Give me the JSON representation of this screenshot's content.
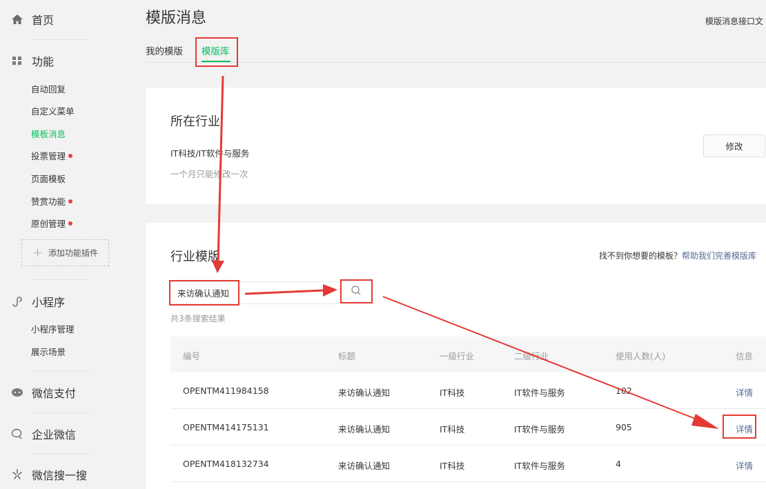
{
  "sidebar": {
    "home": "首页",
    "function": "功能",
    "function_items": [
      {
        "label": "自动回复",
        "dot": false,
        "active": false
      },
      {
        "label": "自定义菜单",
        "dot": false,
        "active": false
      },
      {
        "label": "模板消息",
        "dot": false,
        "active": true
      },
      {
        "label": "投票管理",
        "dot": true,
        "active": false
      },
      {
        "label": "页面模板",
        "dot": false,
        "active": false
      },
      {
        "label": "赞赏功能",
        "dot": true,
        "active": false
      },
      {
        "label": "原创管理",
        "dot": true,
        "active": false
      }
    ],
    "add_plugin": "添加功能插件",
    "miniprogram": "小程序",
    "miniprogram_items": [
      "小程序管理",
      "展示场景"
    ],
    "wechat_pay": "微信支付",
    "work_wechat": "企业微信",
    "wechat_search": "微信搜一搜"
  },
  "header": {
    "title": "模版消息",
    "top_link": "模版消息接口文"
  },
  "tabs": [
    "我的模版",
    "模版库"
  ],
  "industry": {
    "title": "所在行业",
    "value": "IT科技/IT软件与服务",
    "note": "一个月只能修改一次",
    "modify_label": "修改"
  },
  "templates": {
    "title": "行业模版",
    "help_prefix": "找不到你想要的模板？",
    "help_link": "帮助我们完善模版库",
    "search_value": "来访确认通知",
    "result_count": "共3条搜索结果",
    "columns": [
      "编号",
      "标题",
      "一级行业",
      "二级行业",
      "使用人数(人)",
      "信息"
    ],
    "rows": [
      {
        "id": "OPENTM411984158",
        "title": "来访确认通知",
        "industry1": "IT科技",
        "industry2": "IT软件与服务",
        "users": "102",
        "info": "详情"
      },
      {
        "id": "OPENTM414175131",
        "title": "来访确认通知",
        "industry1": "IT科技",
        "industry2": "IT软件与服务",
        "users": "905",
        "info": "详情"
      },
      {
        "id": "OPENTM418132734",
        "title": "来访确认通知",
        "industry1": "IT科技",
        "industry2": "IT软件与服务",
        "users": "4",
        "info": "详情"
      }
    ]
  },
  "colors": {
    "accent": "#07c160",
    "link": "#576b95",
    "annotation": "#e53935",
    "dot": "#e64340"
  },
  "icons": {
    "home": "home-icon",
    "function": "grid-icon",
    "miniprogram": "miniprogram-icon",
    "pay": "wechat-pay-icon",
    "work": "work-wechat-icon",
    "search_one": "wechat-search-icon",
    "search": "search-icon"
  }
}
